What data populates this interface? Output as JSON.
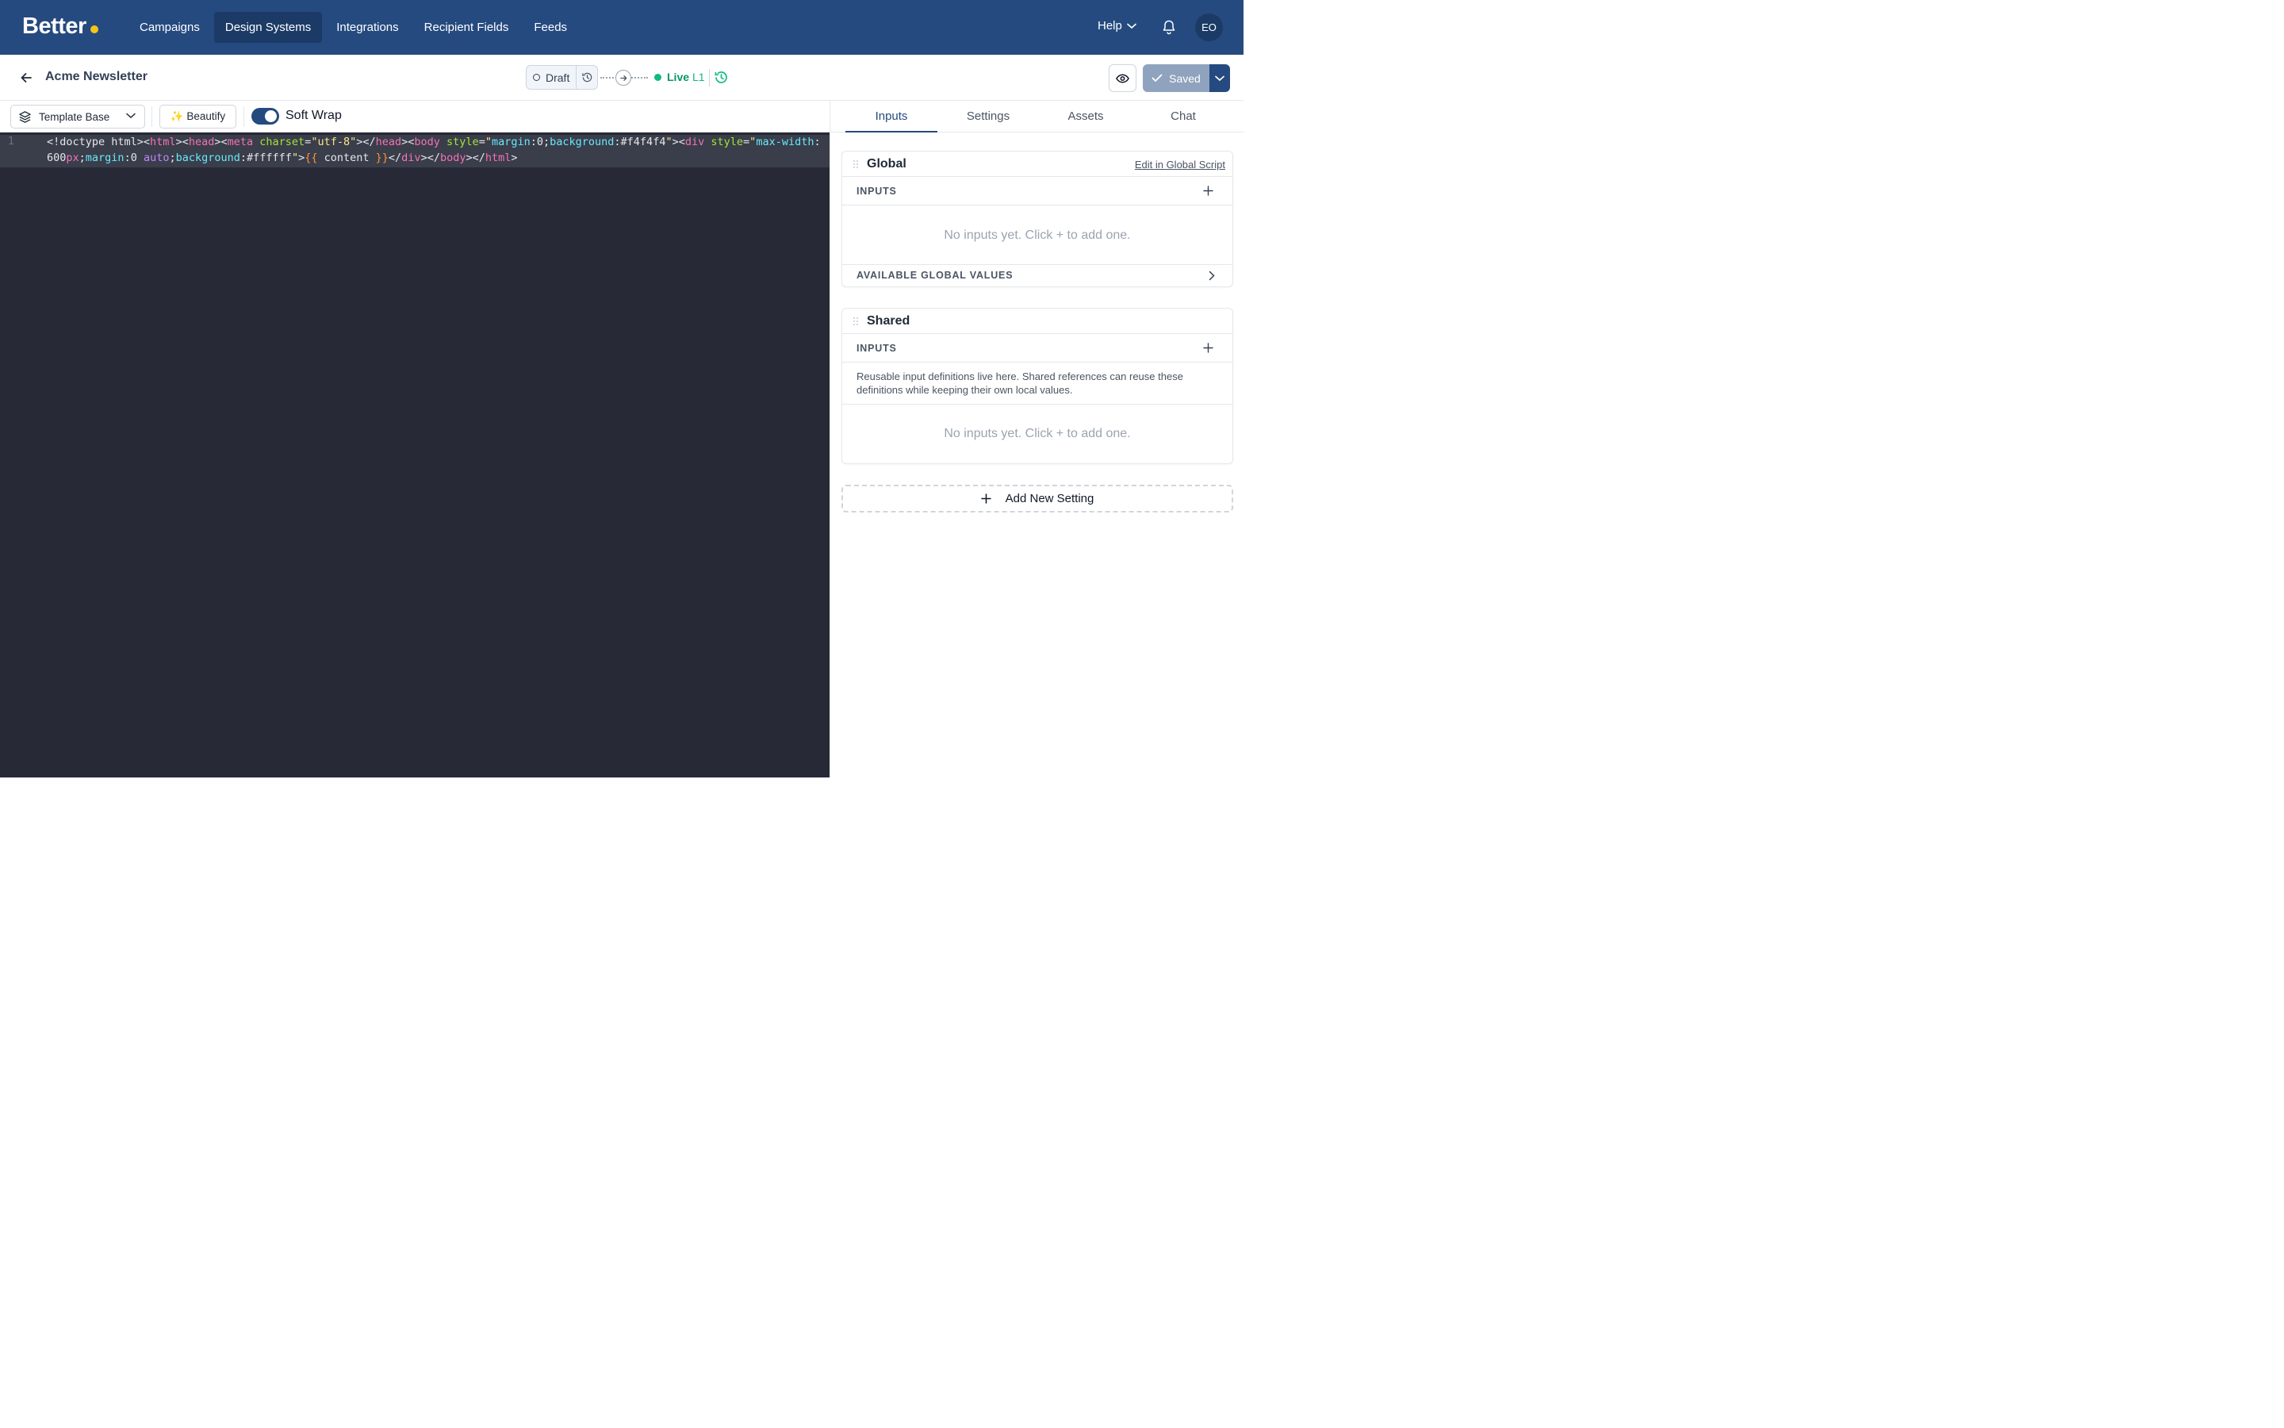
{
  "brand": {
    "name": "Better",
    "dot_color": "#f5c518"
  },
  "nav": {
    "items": [
      {
        "label": "Campaigns"
      },
      {
        "label": "Design Systems"
      },
      {
        "label": "Integrations"
      },
      {
        "label": "Recipient Fields"
      },
      {
        "label": "Feeds"
      }
    ],
    "active_index": 1,
    "help_label": "Help",
    "avatar_initials": "EO"
  },
  "doc": {
    "title": "Acme Newsletter",
    "status_draft": "Draft",
    "status_live": "Live",
    "live_version": "L1",
    "saved_label": "Saved"
  },
  "toolbar": {
    "template_select": "Template Base",
    "beautify_label": "✨ Beautify",
    "soft_wrap_label": "Soft Wrap",
    "soft_wrap_on": true
  },
  "editor": {
    "line_number": "1"
  },
  "right_panel": {
    "tabs": [
      {
        "label": "Inputs"
      },
      {
        "label": "Settings"
      },
      {
        "label": "Assets"
      },
      {
        "label": "Chat"
      }
    ],
    "active_tab": "Inputs",
    "global": {
      "title": "Global",
      "edit_link": "Edit in Global Script",
      "inputs_label": "INPUTS",
      "empty_text": "No inputs yet. Click + to add one.",
      "available_label": "AVAILABLE GLOBAL VALUES"
    },
    "shared": {
      "title": "Shared",
      "inputs_label": "INPUTS",
      "description": "Reusable input definitions live here. Shared references can reuse these definitions while keeping their own local values.",
      "empty_text": "No inputs yet. Click + to add one."
    },
    "add_setting_label": "Add New Setting"
  },
  "colors": {
    "nav_bg": "#254a7f",
    "nav_active": "#1b3a66",
    "editor_bg": "#272a36",
    "live_green": "#10b981",
    "saved_bg": "#8fa3be"
  }
}
